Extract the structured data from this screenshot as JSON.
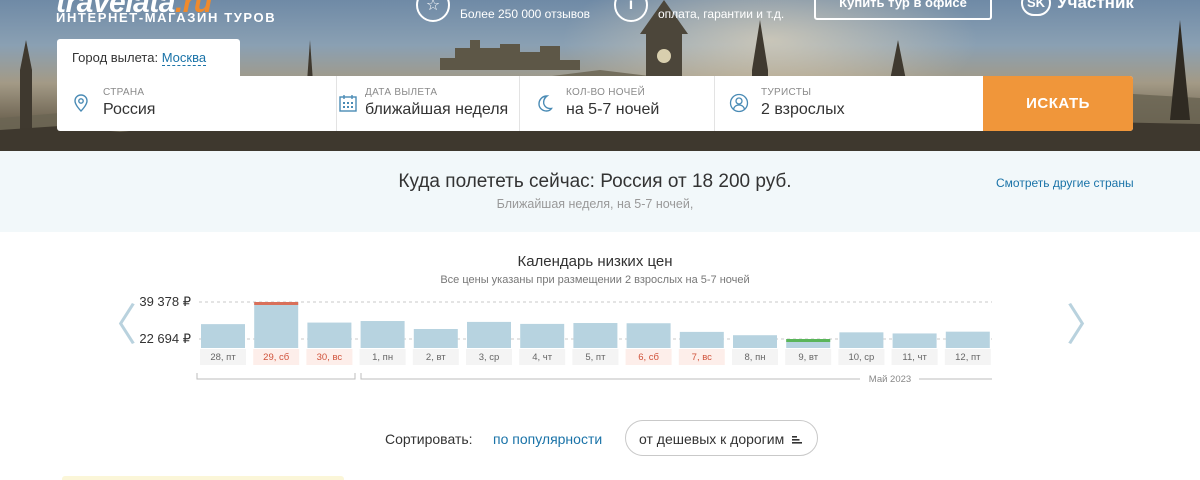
{
  "header": {
    "logo_main": "travelata",
    "logo_tld": ".ru",
    "logo_tagline": "ИНТЕРНЕТ-МАГАЗИН ТУРОВ",
    "reviews_text": "Более 250 000 отзывов",
    "info_text": "оплата, гарантии и т.д.",
    "office_button": "Купить тур в офисе",
    "sk_mark": "SK",
    "sk_text": "Участник"
  },
  "departure": {
    "label": "Город вылета:",
    "city": "Москва"
  },
  "search": {
    "country_label": "СТРАНА",
    "country_value": "Россия",
    "date_label": "ДАТА ВЫЛЕТА",
    "date_value": "ближайшая неделя",
    "nights_label": "КОЛ-ВО НОЧЕЙ",
    "nights_value": "на 5-7 ночей",
    "tourists_label": "ТУРИСТЫ",
    "tourists_value": "2 взрослых",
    "button": "ИСКАТЬ"
  },
  "recommendation": {
    "title": "Куда полететь сейчас: Россия от 18 200 руб.",
    "subtitle": "Ближайшая неделя, на 5-7 ночей,",
    "other_link": "Смотреть другие страны"
  },
  "calendar": {
    "title": "Календарь низких цен",
    "subtitle": "Все цены указаны при размещении 2 взрослых на 5-7 ночей",
    "month_label": "Май 2023"
  },
  "chart_data": {
    "type": "bar",
    "title": "Календарь низких цен",
    "y_ticks": [
      {
        "value": 39378,
        "label": "39 378 ₽"
      },
      {
        "value": 22694,
        "label": "22 694 ₽"
      }
    ],
    "categories": [
      "28, пт",
      "29, сб",
      "30, вс",
      "1, пн",
      "2, вт",
      "3, ср",
      "4, чт",
      "5, пт",
      "6, сб",
      "7, вс",
      "8, пн",
      "9, вт",
      "10, ср",
      "11, чт",
      "12, пт"
    ],
    "weekend": [
      false,
      true,
      true,
      false,
      false,
      false,
      false,
      false,
      true,
      true,
      false,
      false,
      false,
      false,
      false
    ],
    "values": [
      29400,
      39378,
      30100,
      30800,
      27200,
      30400,
      29500,
      29900,
      29800,
      25900,
      24400,
      22694,
      25700,
      25200,
      26000
    ],
    "max_index": 1,
    "min_index": 11,
    "colors": {
      "bar": "#b7d3e0",
      "max_top": "#d9705a",
      "min_top": "#5ab55a",
      "gridline": "#c8c8c8"
    }
  },
  "sort": {
    "label": "Сортировать:",
    "popularity": "по популярности",
    "price": "от дешевых к дорогим"
  }
}
